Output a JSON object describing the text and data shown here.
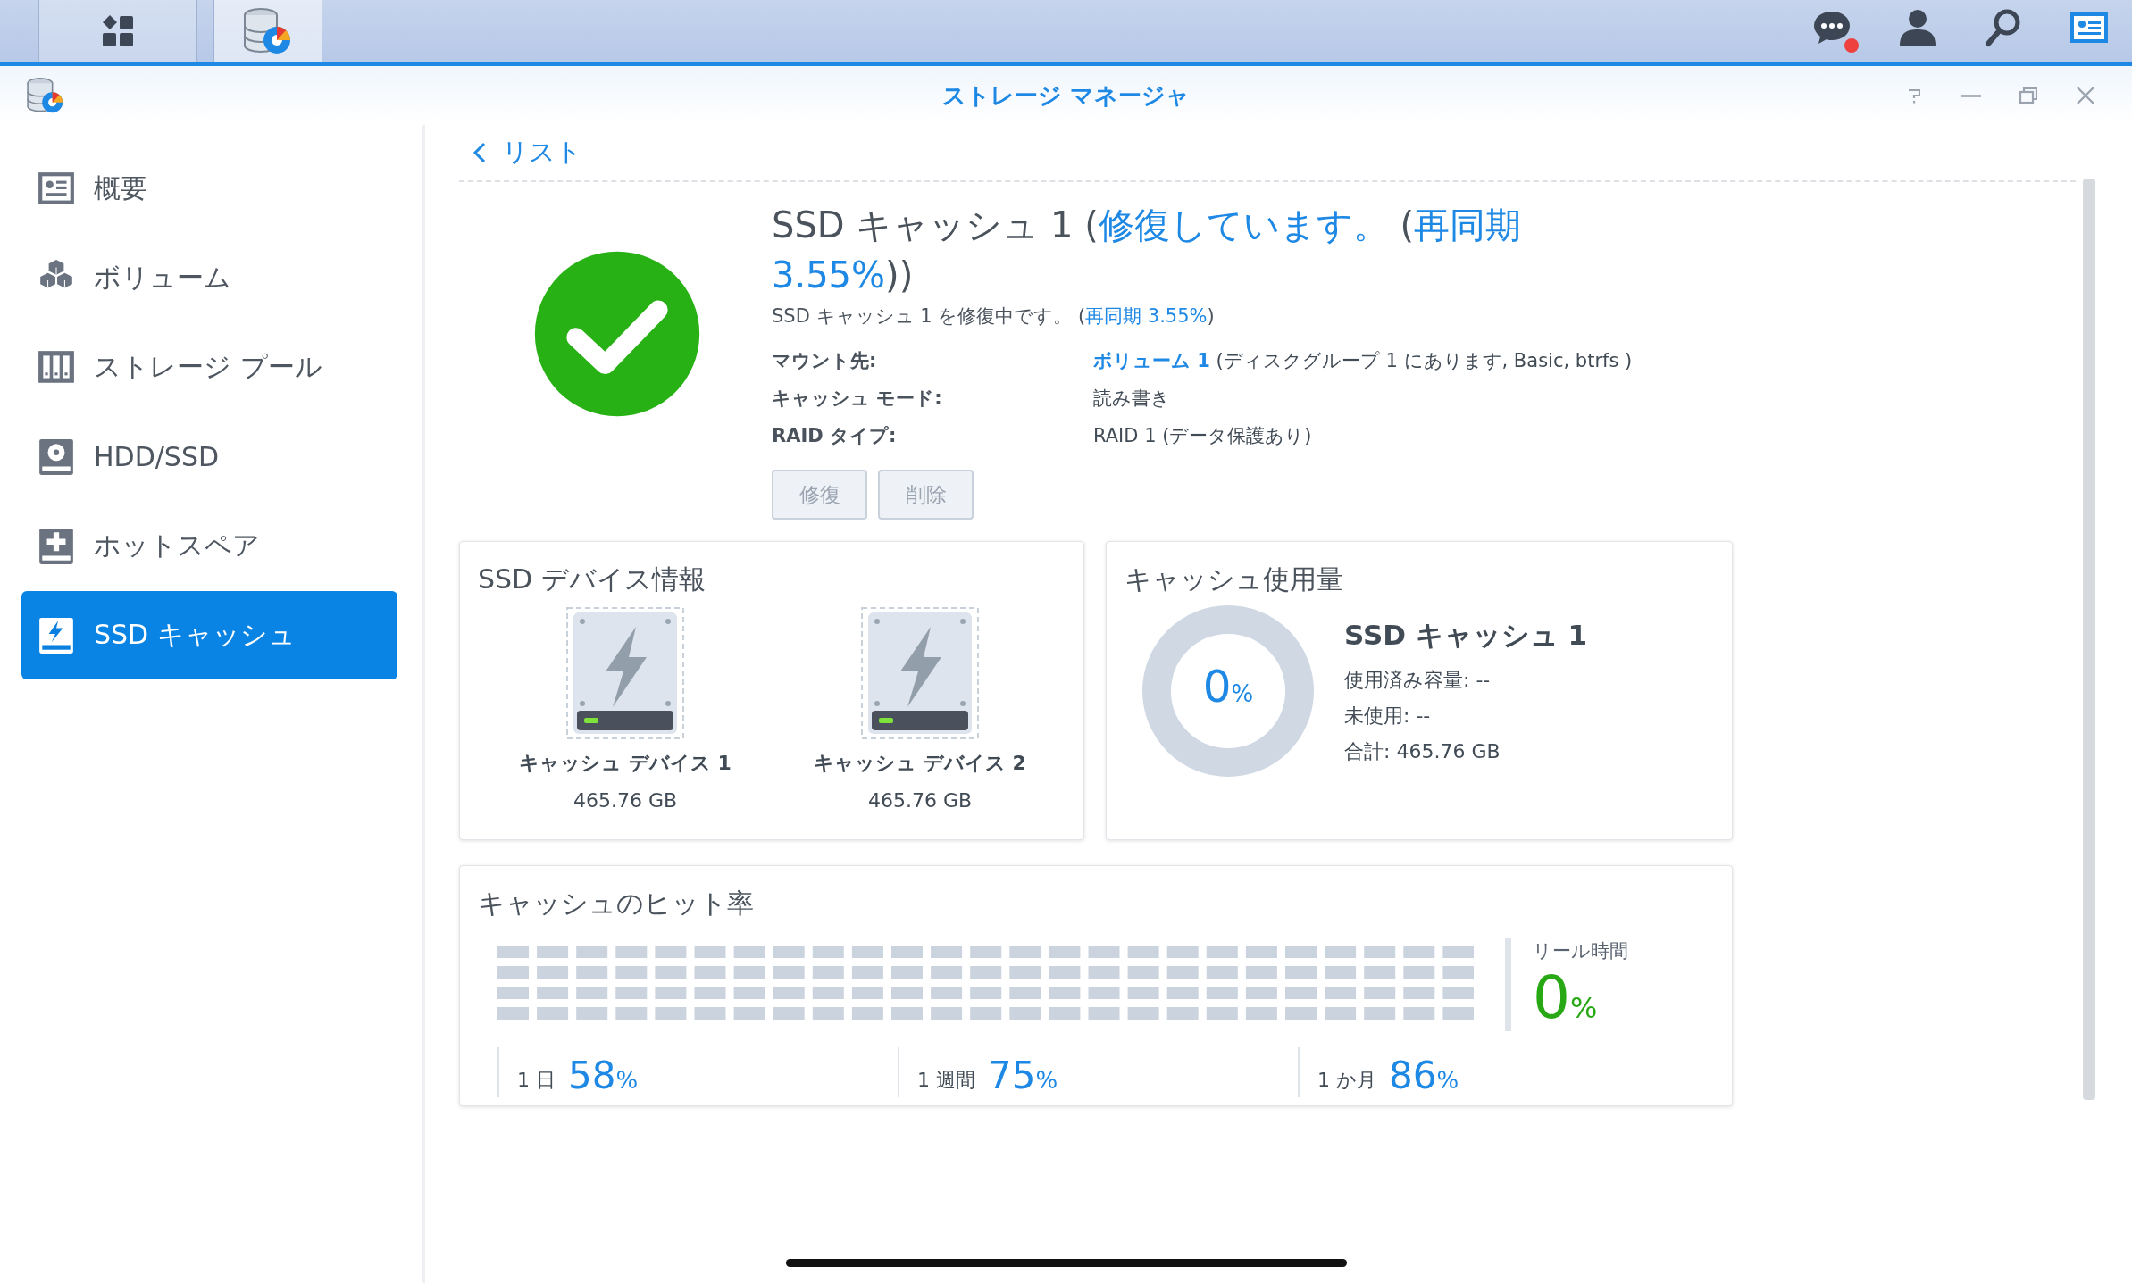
{
  "taskbar": {
    "apps": [
      {
        "kind": "main-menu",
        "selected": false
      },
      {
        "kind": "storage-manager",
        "selected": true
      }
    ],
    "tray": [
      {
        "kind": "messages",
        "alert": true
      },
      {
        "kind": "user",
        "alert": false
      },
      {
        "kind": "search",
        "alert": false
      },
      {
        "kind": "widgets",
        "alert": false
      }
    ]
  },
  "window": {
    "title": "ストレージ マネージャ"
  },
  "sidebar": {
    "items": [
      {
        "label": "概要",
        "kind": "overview",
        "selected": false
      },
      {
        "label": "ボリューム",
        "kind": "volume",
        "selected": false
      },
      {
        "label": "ストレージ プール",
        "kind": "pool",
        "selected": false
      },
      {
        "label": "HDD/SSD",
        "kind": "disk",
        "selected": false
      },
      {
        "label": "ホットスペア",
        "kind": "hotspare",
        "selected": false
      },
      {
        "label": "SSD キャッシュ",
        "kind": "ssd",
        "selected": true
      }
    ]
  },
  "back_link": "リスト",
  "cache": {
    "kind": "healthy",
    "title_parts": [
      {
        "text": "SSD キャッシュ 1 (",
        "kind": "plain"
      },
      {
        "text": "修復しています。",
        "kind": "accent"
      },
      {
        "text": " (",
        "kind": "plain"
      },
      {
        "text": "再同期 3.55%",
        "kind": "accent"
      },
      {
        "text": "))",
        "kind": "plain"
      }
    ],
    "subtitle_parts": [
      {
        "text": "SSD キャッシュ 1 を修復中です。 (",
        "kind": "plain"
      },
      {
        "text": "再同期 3.55%",
        "kind": "accent"
      },
      {
        "text": ")",
        "kind": "plain"
      }
    ],
    "details": [
      {
        "label": "マウント先:",
        "link": "ボリューム 1",
        "value": " (ディスクグループ 1 にあります, Basic, btrfs )"
      },
      {
        "label": "キャッシュ モード:",
        "value": "読み書き"
      },
      {
        "label": "RAID タイプ:",
        "value": "RAID 1 (データ保護あり)"
      }
    ],
    "buttons": [
      {
        "label": "修復",
        "disabled": true
      },
      {
        "label": "削除",
        "disabled": true
      }
    ]
  },
  "device_card": {
    "title": "SSD デバイス情報",
    "devices": [
      {
        "name": "キャッシュ デバイス 1",
        "size": "465.76 GB"
      },
      {
        "name": "キャッシュ デバイス 2",
        "size": "465.76 GB"
      }
    ]
  },
  "usage_card": {
    "title": "キャッシュ使用量",
    "level": 0,
    "percent": "0",
    "unit": "%",
    "name": "SSD キャッシュ 1",
    "lines": [
      "使用済み容量: --",
      "未使用: --",
      "合計: 465.76 GB"
    ]
  },
  "hit_card": {
    "title": "キャッシュのヒット率",
    "realtime": {
      "label": "リール時間",
      "value": "0",
      "unit": "%"
    },
    "stats": [
      {
        "period": "1 日",
        "value": "58",
        "unit": "%"
      },
      {
        "period": "1 週間",
        "value": "75",
        "unit": "%"
      },
      {
        "period": "1 か月",
        "value": "86",
        "unit": "%"
      }
    ]
  }
}
